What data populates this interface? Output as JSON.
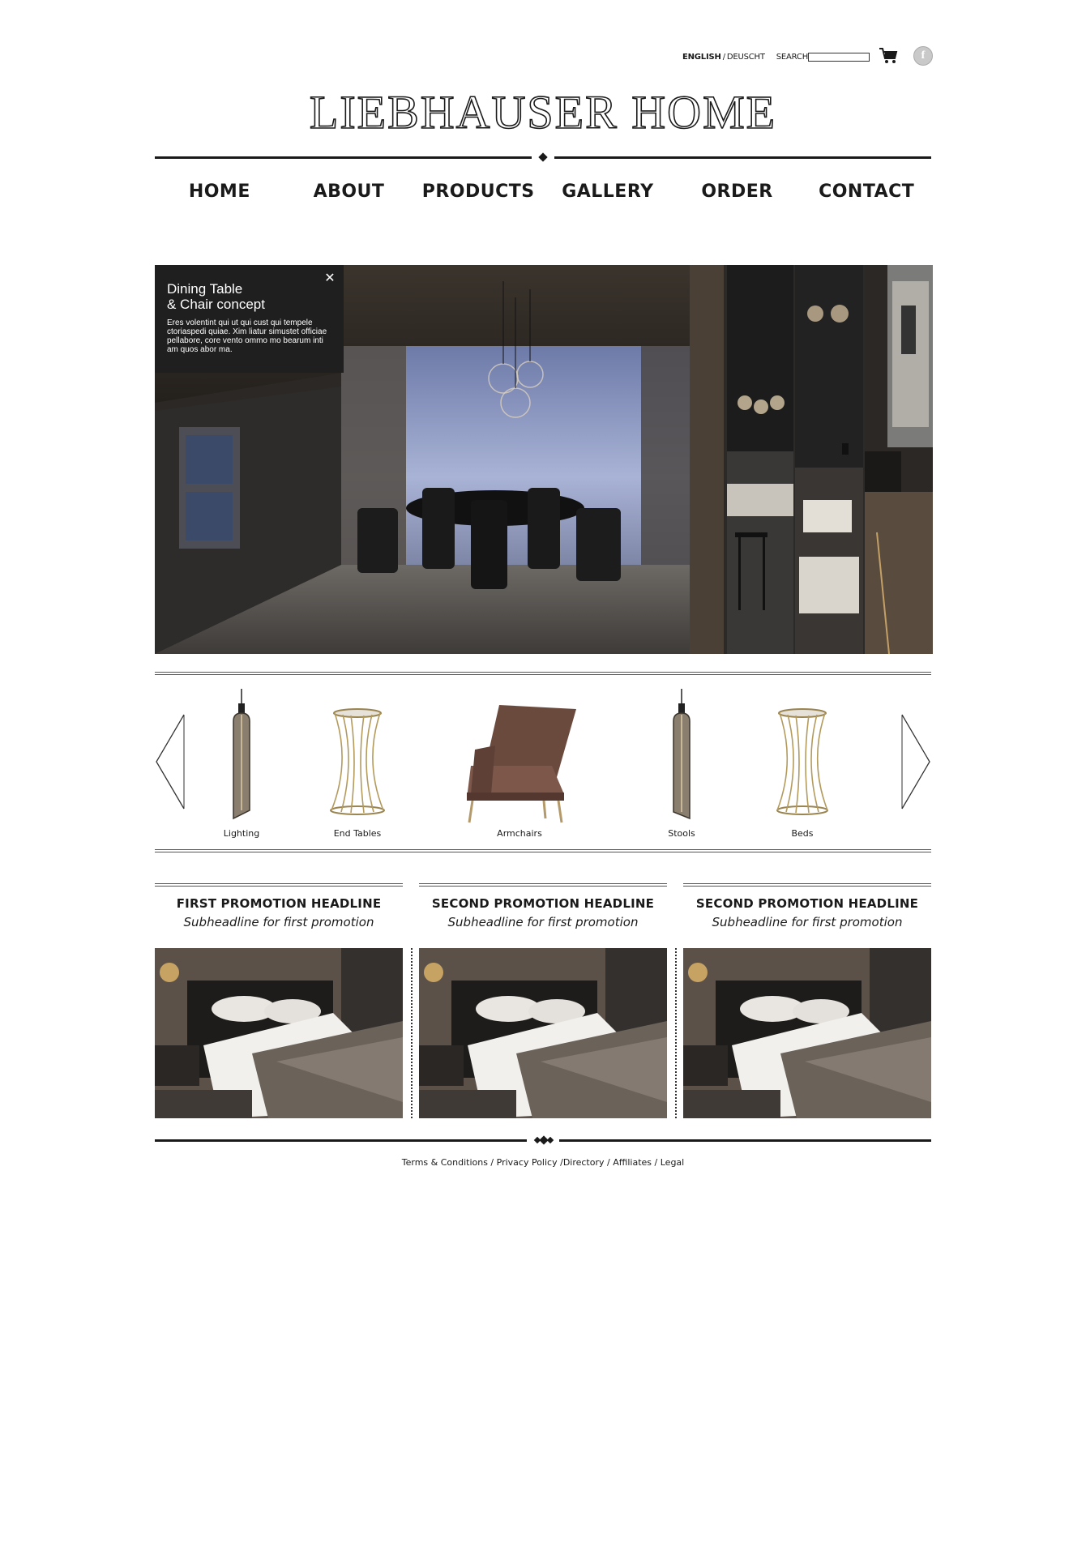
{
  "header": {
    "lang_english": "ENGLISH",
    "lang_separator": "/",
    "lang_german": "DEUSCHT",
    "search_label": "SEARCH",
    "search_value": "",
    "cart_icon": "cart-icon",
    "facebook_icon": "facebook-icon",
    "facebook_glyph": "f"
  },
  "logo": "LIEBHAUSER HOME",
  "nav": {
    "home": "HOME",
    "about": "ABOUT",
    "products": "PRODUCTS",
    "gallery": "GALLERY",
    "order": "ORDER",
    "contact": "CONTACT"
  },
  "hero": {
    "title_line1": "Dining Table",
    "title_line2": "& Chair concept",
    "body": "Eres volentint qui ut qui cust qui tempele ctoriaspedi quiae. Xim liatur simustet officiae pellabore, core vento ommo mo bearum inti am quos abor ma.",
    "close_glyph": "✕"
  },
  "products": [
    {
      "label": "Lighting"
    },
    {
      "label": "End Tables"
    },
    {
      "label": "Armchairs"
    },
    {
      "label": "Stools"
    },
    {
      "label": "Beds"
    }
  ],
  "promos": [
    {
      "headline": "FIRST PROMOTION HEADLINE",
      "subheadline": "Subheadline for first promotion"
    },
    {
      "headline": "SECOND PROMOTION HEADLINE",
      "subheadline": "Subheadline for first promotion"
    },
    {
      "headline": "SECOND PROMOTION HEADLINE",
      "subheadline": "Subheadline for first promotion"
    }
  ],
  "footer": {
    "terms": "Terms & Conditions",
    "sep1": " / ",
    "privacy": "Privacy Policy",
    "sep2": " /",
    "directory": "Directory",
    "sep3": " / ",
    "affiliates": "Affiliates",
    "sep4": " / ",
    "legal": "Legal"
  }
}
